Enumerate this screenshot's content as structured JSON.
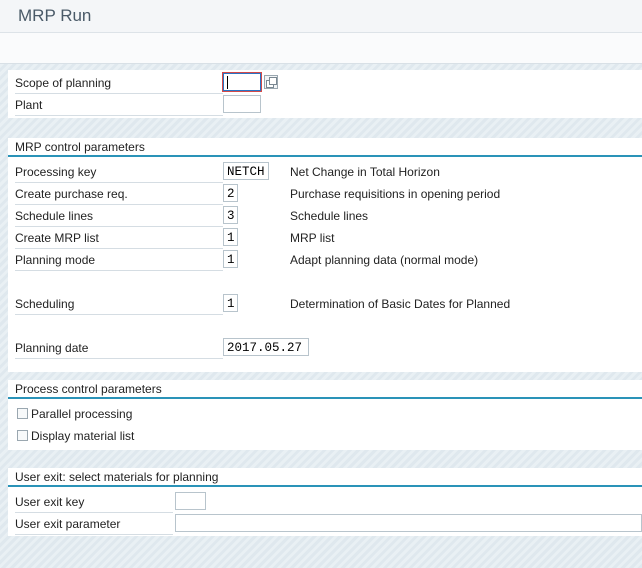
{
  "window": {
    "title": "MRP Run"
  },
  "scope": {
    "scope_label": "Scope of planning",
    "scope_value": "",
    "plant_label": "Plant",
    "plant_value": ""
  },
  "mrp_control": {
    "header": "MRP control parameters",
    "rows": [
      {
        "label": "Processing key",
        "value": "NETCH",
        "desc": "Net Change in Total Horizon"
      },
      {
        "label": "Create purchase req.",
        "value": "2",
        "desc": "Purchase requisitions in opening period"
      },
      {
        "label": "Schedule lines",
        "value": "3",
        "desc": "Schedule lines"
      },
      {
        "label": "Create MRP list",
        "value": "1",
        "desc": "MRP list"
      },
      {
        "label": "Planning mode",
        "value": "1",
        "desc": "Adapt planning data (normal mode)"
      },
      {
        "label": "Scheduling",
        "value": "1",
        "desc": "Determination of Basic Dates for Planned"
      },
      {
        "label": "Planning date",
        "value": "2017.05.27",
        "desc": ""
      }
    ]
  },
  "process_control": {
    "header": "Process control parameters",
    "options": [
      {
        "label": "Parallel processing",
        "checked": false
      },
      {
        "label": "Display material list",
        "checked": false
      }
    ]
  },
  "user_exit": {
    "header": "User exit: select materials for planning",
    "key_label": "User exit key",
    "key_value": "",
    "param_label": "User exit parameter",
    "param_value": ""
  },
  "colors": {
    "accent": "#2a93b8",
    "focus": "#d24a4a"
  }
}
